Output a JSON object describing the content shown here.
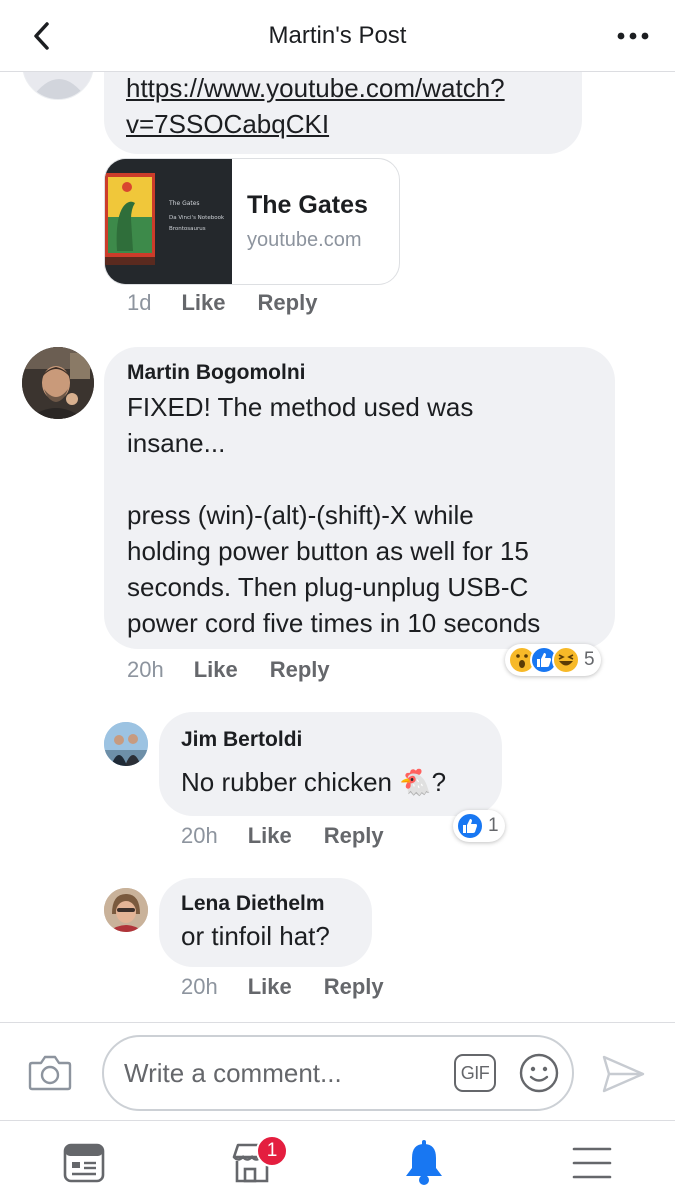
{
  "header": {
    "title": "Martin's Post",
    "back_icon": "chevron-left-icon",
    "more_icon": "more-dots-icon"
  },
  "comments": [
    {
      "link_lines": [
        "https://www.youtube.com/watch?",
        "v=7SSOCabqCKI"
      ],
      "link_preview": {
        "title": "The Gates",
        "domain": "youtube.com",
        "thumb_lines": [
          "The Gates",
          "Da Vinci's Notebook",
          "Brontosaurus"
        ]
      },
      "time": "1d",
      "like_label": "Like",
      "reply_label": "Reply"
    },
    {
      "author": "Martin Bogomolni",
      "text_lines": [
        "FIXED!  The method used was",
        "insane...",
        "",
        "press (win)-(alt)-(shift)-X while",
        "holding power button as well for 15",
        "seconds.  Then plug-unplug USB-C",
        "power cord five times in 10 seconds"
      ],
      "time": "20h",
      "like_label": "Like",
      "reply_label": "Reply",
      "reactions": [
        "wow-icon",
        "like-icon",
        "haha-icon"
      ],
      "reaction_count": "5"
    },
    {
      "author": "Jim Bertoldi",
      "text": "No rubber chicken 🐔?",
      "time": "20h",
      "like_label": "Like",
      "reply_label": "Reply",
      "reactions": [
        "like-icon"
      ],
      "reaction_count": "1"
    },
    {
      "author": "Lena Diethelm",
      "text": "or tinfoil hat?",
      "time": "20h",
      "like_label": "Like",
      "reply_label": "Reply"
    }
  ],
  "composer": {
    "placeholder": "Write a comment...",
    "gif_label": "GIF",
    "camera_icon": "camera-icon",
    "emoji_icon": "emoji-icon",
    "send_icon": "send-icon"
  },
  "bottom_nav": {
    "items": [
      "news-feed-icon",
      "marketplace-icon",
      "notifications-icon",
      "menu-icon"
    ],
    "marketplace_badge": "1",
    "active": "notifications-icon"
  },
  "colors": {
    "accent": "#1877f2",
    "bubble": "#f0f1f4",
    "badge": "#e41e3f",
    "reaction_yellow": "#f7b928"
  }
}
